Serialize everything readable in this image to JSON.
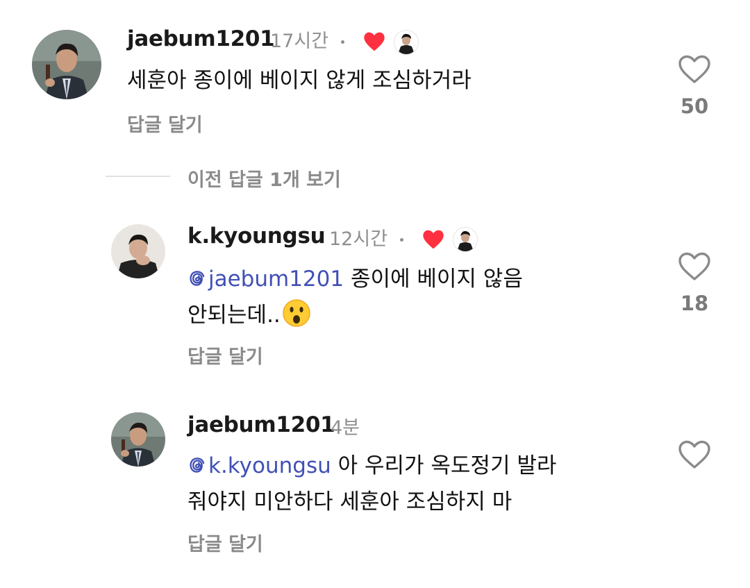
{
  "comments": [
    {
      "username": "jaebum1201",
      "time": "17시간",
      "text": "세훈아 종이에 베이지 않게 조심하거라",
      "reply_label": "답글 달기",
      "likes": "50",
      "liked_by_creator": true
    },
    {
      "username": "k.kyoungsu",
      "time": "12시간",
      "mention": "jaebum1201",
      "text_line1": "종이에 베이지 않음",
      "text_line2": "안되는데..",
      "emoji": "hushed-face",
      "reply_label": "답글 달기",
      "likes": "18",
      "liked_by_creator": true
    },
    {
      "username": "jaebum1201",
      "time": "4분",
      "mention": "k.kyoungsu",
      "text_line1": "아 우리가 옥도정기 발라",
      "text_line2": "줘야지 미안하다 세훈아 조심하지 마",
      "reply_label": "답글 달기",
      "likes": "",
      "liked_by_creator": false
    }
  ],
  "thread": {
    "view_previous_label": "이전 답글 1개 보기"
  },
  "colors": {
    "heart_red": "#ff3040",
    "mention_blue": "#4150b5",
    "muted_gray": "#8e8e8e"
  }
}
